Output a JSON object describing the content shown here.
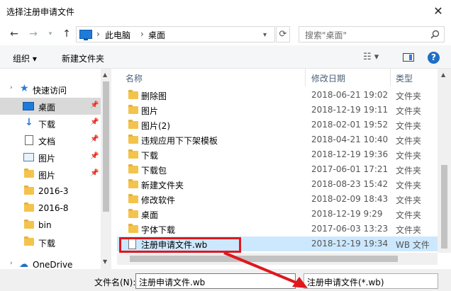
{
  "window": {
    "title": "选择注册申请文件",
    "close": "✕"
  },
  "address": {
    "segments": [
      "此电脑",
      "桌面"
    ],
    "separator": "›",
    "search_placeholder": "搜索\"桌面\""
  },
  "toolbar": {
    "organize": "组织 ▾",
    "new_folder": "新建文件夹"
  },
  "nav": {
    "quick_access": "快速访问",
    "items": [
      {
        "label": "桌面",
        "pinned": true,
        "selected": true
      },
      {
        "label": "下载",
        "pinned": true
      },
      {
        "label": "文档",
        "pinned": true
      },
      {
        "label": "图片",
        "pinned": true
      },
      {
        "label": "图片",
        "pinned": true
      },
      {
        "label": "2016-3"
      },
      {
        "label": "2016-8"
      },
      {
        "label": "bin"
      },
      {
        "label": "下载"
      }
    ],
    "onedrive": "OneDrive"
  },
  "columns": {
    "name": "名称",
    "date": "修改日期",
    "type": "类型"
  },
  "files": [
    {
      "name": "删除图",
      "date": "2018-06-21 19:02",
      "type": "文件夹"
    },
    {
      "name": "图片",
      "date": "2018-12-19 19:11",
      "type": "文件夹"
    },
    {
      "name": "图片(2)",
      "date": "2018-02-01 19:52",
      "type": "文件夹"
    },
    {
      "name": "违规应用下下架模板",
      "date": "2018-04-21 10:40",
      "type": "文件夹"
    },
    {
      "name": "下载",
      "date": "2018-12-19 19:36",
      "type": "文件夹"
    },
    {
      "name": "下载包",
      "date": "2017-06-01 17:21",
      "type": "文件夹"
    },
    {
      "name": "新建文件夹",
      "date": "2018-08-23 15:42",
      "type": "文件夹"
    },
    {
      "name": "修改软件",
      "date": "2018-02-09 18:43",
      "type": "文件夹"
    },
    {
      "name": "桌面",
      "date": "2018-12-19 9:29",
      "type": "文件夹"
    },
    {
      "name": "字体下载",
      "date": "2017-06-03 13:23",
      "type": "文件夹"
    },
    {
      "name": "注册申请文件.wb",
      "date": "2018-12-19 19:34",
      "type": "WB 文件"
    }
  ],
  "bottom": {
    "filename_label": "文件名(N):",
    "filename_value": "注册申请文件.wb",
    "filetype_value": "注册申请文件(*.wb)"
  },
  "colors": {
    "selection": "#cce8ff",
    "highlight": "#e0171d",
    "folder": "#f3c34c"
  }
}
